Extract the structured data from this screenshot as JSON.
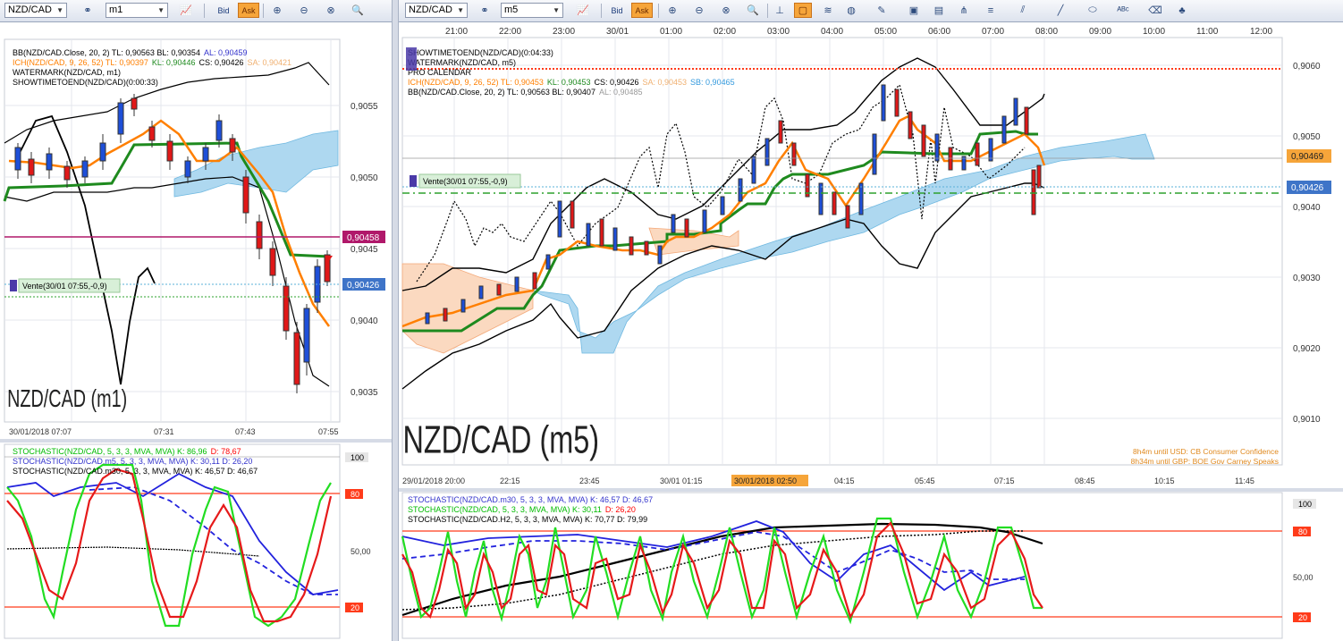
{
  "left_window": {
    "toolbar": {
      "symbol": "NZD/CAD",
      "timeframe": "m1",
      "bid_label": "Bid",
      "ask_label": "Ask"
    },
    "price_axis": [
      "0,9055",
      "0,9050",
      "0,9045",
      "0,9040",
      "0,9035"
    ],
    "price_tag_magenta": "0,90458",
    "price_tag_blue": "0,90426",
    "time_axis": [
      "30/01/2018 07:07",
      "07:31",
      "07:43",
      "07:55"
    ],
    "legend": [
      {
        "text": "BB(NZD/CAD.Close, 20, 2)  TL: 0,90563  BL: 0,90354",
        "extra": "AL: 0,90459",
        "color": "#000000",
        "extra_color": "#3333cc"
      },
      {
        "text": "ICH(NZD/CAD, 9, 26, 52)  TL: 0,90397",
        "extra": "KL: 0,90446",
        "extra2": "CS: 0,90426",
        "extra3": "SA: 0,90421",
        "color": "#ff7f00",
        "extra_color": "#1e8a1e",
        "extra2_color": "#000000",
        "extra3_color": "#f0b070"
      },
      {
        "text": "WATERMARK(NZD/CAD, m1)",
        "color": "#000000"
      },
      {
        "text": "SHOWTIMETOEND(NZD/CAD)(0:00:33)",
        "color": "#000000"
      }
    ],
    "vente_label": "Vente(30/01 07:55,-0,9)",
    "watermark": "NZD/CAD (m1)",
    "stochastic": {
      "legend": [
        {
          "text": "STOCHASTIC(NZD/CAD, 5, 3, 3, MVA, MVA)  K: 86,96",
          "extra": "D: 78,67",
          "color": "#00cc00",
          "extra_color": "#ff0000"
        },
        {
          "text": "STOCHASTIC(NZD/CAD.m5, 5, 3, 3, MVA, MVA)  K: 30,11  D: 26,20",
          "color": "#3333cc"
        },
        {
          "text": "STOCHASTIC(NZD/CAD.m30, 5, 3, 3, MVA, MVA)  K: 46,57  D: 46,67",
          "color": "#000000"
        }
      ],
      "axis": [
        "100",
        "80",
        "50,00",
        "20"
      ]
    }
  },
  "right_window": {
    "toolbar": {
      "symbol": "NZD/CAD",
      "timeframe": "m5",
      "bid_label": "Bid",
      "ask_label": "Ask"
    },
    "top_time_axis": [
      "21:00",
      "22:00",
      "23:00",
      "30/01",
      "01:00",
      "02:00",
      "03:00",
      "04:00",
      "05:00",
      "06:00",
      "07:00",
      "08:00",
      "09:00",
      "10:00",
      "11:00",
      "12:00"
    ],
    "price_axis": [
      "0,9060",
      "0,9050",
      "0,9040",
      "0,9030",
      "0,9020",
      "0,9010"
    ],
    "price_tag_orange": "0,90469",
    "price_tag_blue": "0,90426",
    "legend": [
      {
        "text": "SHOWTIMETOEND(NZD/CAD)(0:04:33)",
        "color": "#000000"
      },
      {
        "text": "WATERMARK(NZD/CAD, m5)",
        "color": "#000000"
      },
      {
        "text": "PRO CALENDAR",
        "color": "#000000"
      },
      {
        "text": "ICH(NZD/CAD, 9, 26, 52)  TL: 0,90453",
        "extra": "KL: 0,90453",
        "extra2": "CS: 0,90426",
        "extra3": "SA: 0,90453",
        "extra4": "SB: 0,90465",
        "color": "#ff7f00",
        "extra_color": "#1e8a1e",
        "extra2_color": "#000000",
        "extra3_color": "#f0b070",
        "extra4_color": "#3399dd"
      },
      {
        "text": "BB(NZD/CAD.Close, 20, 2)  TL: 0,90563  BL: 0,90407",
        "extra": "AL: 0,90485",
        "color": "#000000",
        "extra_color": "#999999"
      }
    ],
    "vente_label": "Vente(30/01 07:55,-0,9)",
    "watermark": "NZD/CAD (m5)",
    "calendar_events": [
      "8h4m until USD: CB Consumer Confidence",
      "8h34m until GBP: BOE Gov Carney Speaks"
    ],
    "bottom_time_axis": [
      "29/01/2018 20:00",
      "22:15",
      "23:45",
      "30/01 01:15",
      "30/01/2018 02:50",
      "04:15",
      "05:45",
      "07:15",
      "08:45",
      "10:15",
      "11:45"
    ],
    "stochastic": {
      "legend": [
        {
          "text": "STOCHASTIC(NZD/CAD.m30, 5, 3, 3, MVA, MVA)  K: 46,57  D: 46,67",
          "color": "#3333cc"
        },
        {
          "text": "STOCHASTIC(NZD/CAD, 5, 3, 3, MVA, MVA)  K: 30,11",
          "extra": "D: 26,20",
          "color": "#00cc00",
          "extra_color": "#ff0000"
        },
        {
          "text": "STOCHASTIC(NZD/CAD.H2, 5, 3, 3, MVA, MVA)  K: 70,77  D: 79,99",
          "color": "#000000"
        }
      ],
      "axis": [
        "100",
        "80",
        "50,00",
        "20"
      ]
    }
  }
}
